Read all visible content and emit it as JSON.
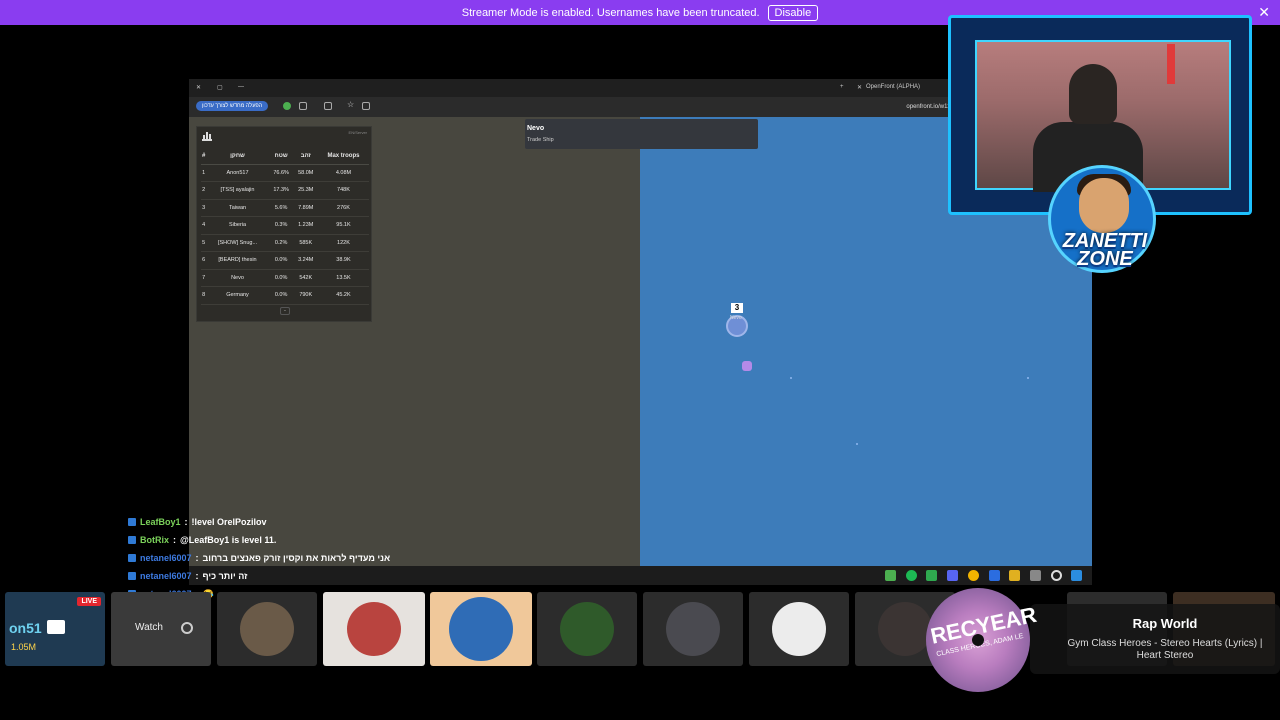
{
  "banner": {
    "text": "Streamer Mode is enabled. Usernames have been truncated.",
    "button": "Disable",
    "close": "✕"
  },
  "browser": {
    "tab_title": "OpenFront (ALPHA)",
    "url": "openfront.io/w11/",
    "bookmark_pill": "הפעלה מחדש לצורך עדכון"
  },
  "leaderboard": {
    "tag": "EN/Server",
    "headers": [
      "#",
      "שחקן",
      "שטח",
      "זהב",
      "Max troops"
    ],
    "rows": [
      [
        "1",
        "Anon517",
        "76.6%",
        "58.0M",
        "4.08M"
      ],
      [
        "2",
        "[TSS] ayalajin",
        "17.3%",
        "25.3M",
        "748K"
      ],
      [
        "3",
        "Taiwan",
        "5.6%",
        "7.89M",
        "276K"
      ],
      [
        "4",
        "Siberia",
        "0.3%",
        "1.23M",
        "95.1K"
      ],
      [
        "5",
        "[SHOW] Snug...",
        "0.2%",
        "585K",
        "122K"
      ],
      [
        "6",
        "[BEARD] thesin",
        "0.0%",
        "3.24M",
        "38.9K"
      ],
      [
        "7",
        "Nevo",
        "0.0%",
        "542K",
        "13.5K"
      ],
      [
        "8",
        "Germany",
        "0.0%",
        "790K",
        "45.2K"
      ]
    ],
    "more": "-"
  },
  "tooltip": {
    "name": "Nevo",
    "kind": "Trade Ship"
  },
  "map": {
    "ship_number": "3",
    "ship_label": "Nevo"
  },
  "chat": [
    {
      "user": "LeafBoy1",
      "color": "#7cd35b",
      "sep": ":",
      "msg": "!level OrelPozilov"
    },
    {
      "user": "BotRix",
      "color": "#7cd35b",
      "sep": ":",
      "msg": "@LeafBoy1 is level 11."
    },
    {
      "user": "netanel6007",
      "color": "#3d7ae0",
      "sep": ":",
      "msg": "אני מעדיף לראות את וקסין זורק פאנצים ברחוב"
    },
    {
      "user": "netanel6007",
      "color": "#3d7ae0",
      "sep": ":",
      "msg": "זה יותר כיף"
    },
    {
      "user": "netanel6007",
      "color": "#3d7ae0",
      "sep": ":",
      "msg": "😂"
    }
  ],
  "tiles": {
    "live_badge": "LIVE",
    "overlay_text1": "on51",
    "overlay_text2": "1.05M",
    "watch_label": "Watch"
  },
  "now_playing": {
    "title": "Rap World",
    "song": "Gym Class Heroes - Stereo Hearts (Lyrics) | Heart Stereo",
    "disc_text": "RECYEAR",
    "disc_sub": "CLASS HEROES, ADAM LE"
  },
  "webcam": {
    "logo_line1": "ZANETTI",
    "logo_line2": "ZONE"
  },
  "colors": {
    "banner": "#8a3df0",
    "ocean": "#3d7cba",
    "land": "#48473f",
    "live": "#e3262e"
  }
}
